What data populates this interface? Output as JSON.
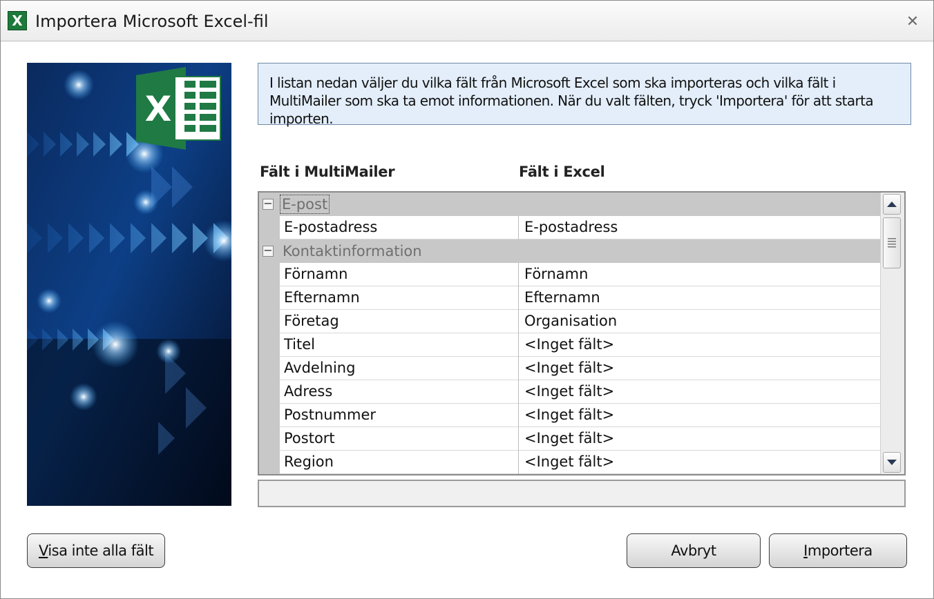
{
  "window": {
    "title": "Importera Microsoft Excel-fil",
    "close_glyph": "✕"
  },
  "banner": {
    "logo_letter": "X",
    "colors": {
      "dark": "#04112e",
      "blue": "#0d3f86",
      "accent": "#3aa9ff",
      "excel_green": "#1f7a44"
    }
  },
  "info": {
    "text": "I listan nedan väljer du vilka fält från Microsoft Excel som ska importeras och vilka fält i MultiMailer som ska ta emot informationen. När du valt fälten, tryck 'Importera' för att starta importen."
  },
  "columns": {
    "left_header": "Fält i MultiMailer",
    "right_header": "Fält i Excel"
  },
  "groups": [
    {
      "label": "E-post",
      "rows": [
        {
          "field": "E-postadress",
          "excel": "E-postadress"
        }
      ]
    },
    {
      "label": "Kontaktinformation",
      "rows": [
        {
          "field": "Förnamn",
          "excel": "Förnamn"
        },
        {
          "field": "Efternamn",
          "excel": "Efternamn"
        },
        {
          "field": "Företag",
          "excel": "Organisation"
        },
        {
          "field": "Titel",
          "excel": "<Inget fält>"
        },
        {
          "field": "Avdelning",
          "excel": "<Inget fält>"
        },
        {
          "field": "Adress",
          "excel": "<Inget fält>"
        },
        {
          "field": "Postnummer",
          "excel": "<Inget fält>"
        },
        {
          "field": "Postort",
          "excel": "<Inget fält>"
        },
        {
          "field": "Region",
          "excel": "<Inget fält>"
        }
      ]
    }
  ],
  "buttons": {
    "show_fields_u": "V",
    "show_fields_rest": "isa inte alla fält",
    "cancel": "Avbryt",
    "import_u": "I",
    "import_rest": "mportera"
  },
  "icons": {
    "expander": "−",
    "scroll_up": "▲",
    "scroll_down": "▼"
  }
}
